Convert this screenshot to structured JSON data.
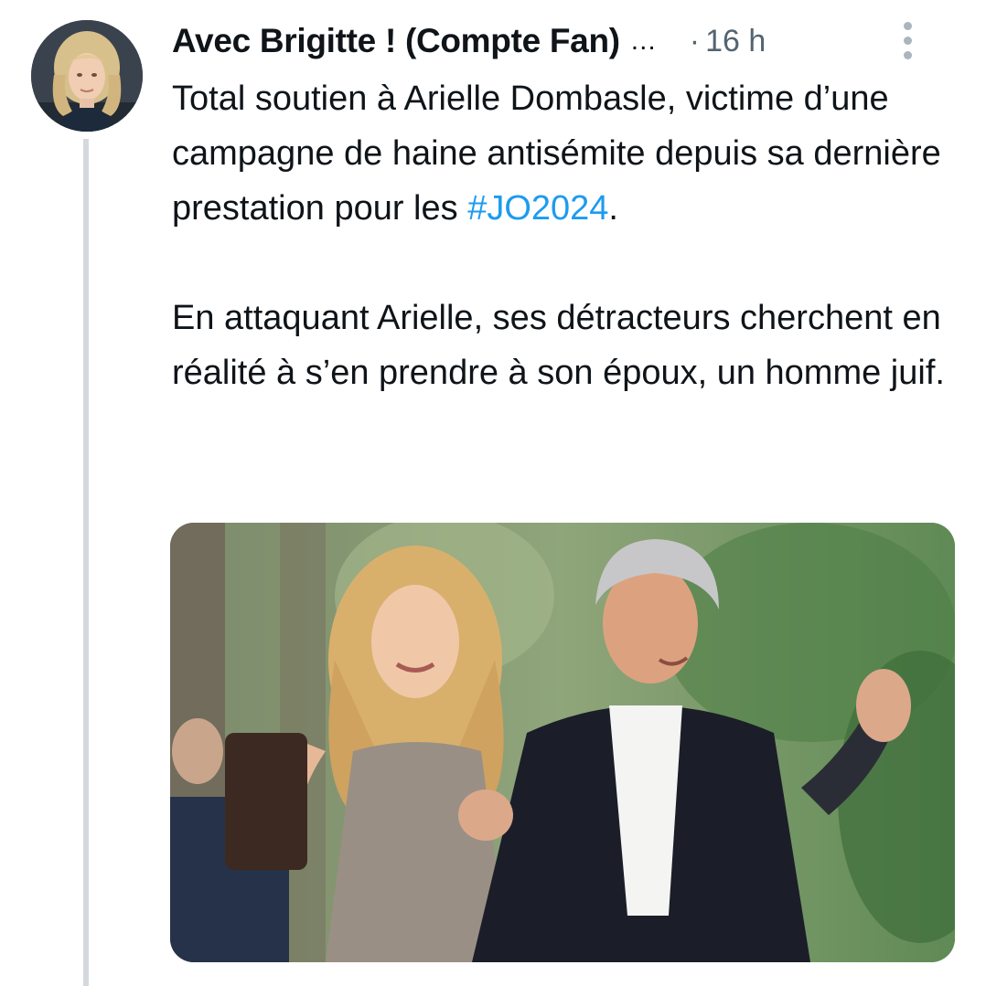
{
  "tweet": {
    "display_name": "Avec Brigitte ! (Compte Fan)",
    "name_ellipsis": "...",
    "separator": "·",
    "time": "16 h",
    "text_line1": "Total soutien à Arielle Dombasle, victime d’une campagne de haine antisémite depuis sa dernière prestation pour les ",
    "hashtag": "#JO2024",
    "text_line1_end": ".",
    "text_paragraph2": "En attaquant Arielle, ses détracteurs cherchent en réalité à s’en prendre à son époux, un homme juif."
  },
  "icons": {
    "more": "more-vertical-icon"
  },
  "colors": {
    "text": "#0f1419",
    "muted": "#536471",
    "link": "#1d9bf0",
    "thread_line": "#d4d9de"
  }
}
